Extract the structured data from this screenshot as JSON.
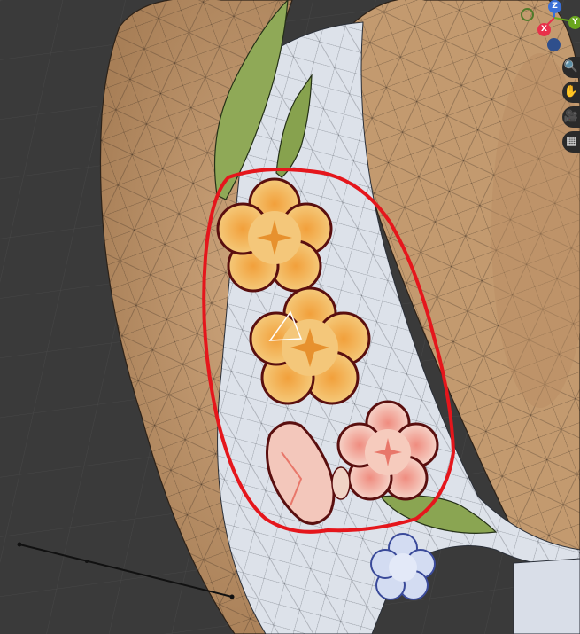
{
  "app": "3D Viewport",
  "gizmo": {
    "x_axis_label": "X",
    "y_axis_label": "Y",
    "z_axis_label": "Z",
    "x_color": "#e8304a",
    "y_color": "#6aa61e",
    "z_color": "#3a6fd6"
  },
  "navigation": {
    "pan_icon": "hand-icon",
    "zoom_icon": "magnifier-icon",
    "camera_icon": "camera-icon",
    "grid_icon": "grid-icon"
  },
  "scene": {
    "annotation_color": "#e5161c",
    "hat_color": "#c49b70",
    "ribbon_color": "#dfe3ec",
    "leaf_color": "#8aa552",
    "orange_flower_color": "#f0b968",
    "pink_flower_color": "#f3c2b5",
    "blue_flower_color": "#c9d4ee"
  }
}
